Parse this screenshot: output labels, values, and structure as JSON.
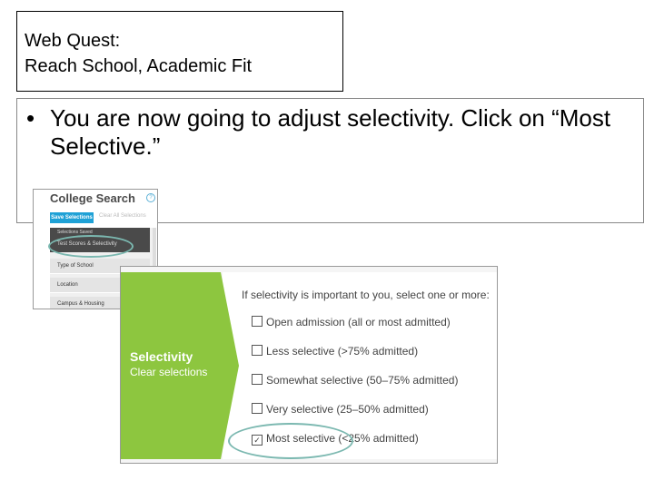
{
  "slide": {
    "title_line1": "Web Quest:",
    "title_line2": "Reach School, Academic Fit",
    "bullet": "•",
    "instruction": "You are now going to adjust selectivity.  Click on “Most Selective.”"
  },
  "college_search": {
    "title": "College Search",
    "help_icon": "?",
    "save_button": "Save Selections",
    "clear_all": "Clear All Selections",
    "nav_items": [
      {
        "label": "Selections Saved",
        "active": true
      },
      {
        "label": "Test Scores & Selectivity",
        "active": true
      },
      {
        "label": "Type of School",
        "active": false
      },
      {
        "label": "Location",
        "active": false
      },
      {
        "label": "Campus & Housing",
        "active": false
      }
    ]
  },
  "selectivity_panel": {
    "heading": "Selectivity",
    "clear_link": "Clear selections",
    "prompt": "If selectivity is important to you, select one or more:",
    "options": [
      {
        "label": "Open admission (all or most admitted)",
        "checked": false
      },
      {
        "label": "Less selective (>75% admitted)",
        "checked": false
      },
      {
        "label": "Somewhat selective (50–75% admitted)",
        "checked": false
      },
      {
        "label": "Very selective (25–50% admitted)",
        "checked": false
      },
      {
        "label": "Most selective (<25% admitted)",
        "checked": true
      }
    ],
    "check_mark": "✓"
  },
  "colors": {
    "accent_green": "#8dc63f",
    "save_blue": "#1fa1d6",
    "highlight_ring": "#7bb8b0"
  }
}
